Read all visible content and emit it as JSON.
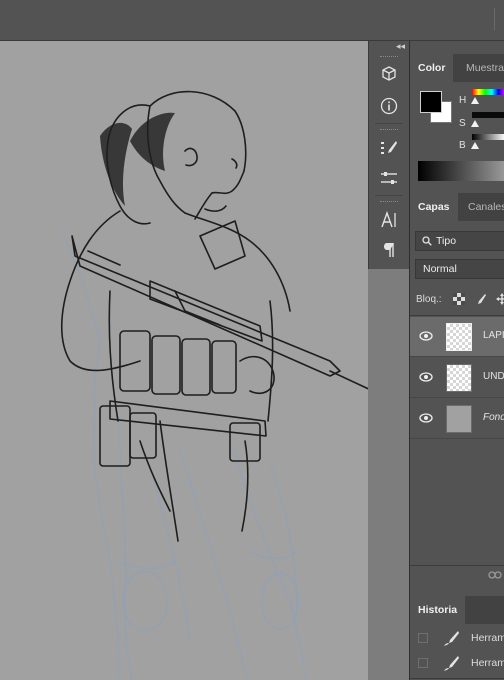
{
  "canvas": {
    "artwork": "figure-drawing-soldier-sketch"
  },
  "color_panel": {
    "tabs": [
      "Color",
      "Muestras"
    ],
    "slider_labels": [
      "H",
      "S",
      "B"
    ],
    "hsb_fill": [
      0.0,
      0.0,
      0.0
    ],
    "foreground_color": "#000000",
    "background_color": "#ffffff"
  },
  "layers_panel": {
    "tabs": [
      "Capas",
      "Canales"
    ],
    "filter_kind": "Tipo",
    "blend_mode": "Normal",
    "lock_label": "Bloq.:",
    "layers": [
      {
        "name": "LAPI",
        "visible": true,
        "selected": true,
        "italic": false
      },
      {
        "name": "UNDI",
        "visible": true,
        "selected": false,
        "italic": false
      },
      {
        "name": "Fond",
        "visible": true,
        "selected": false,
        "italic": true
      }
    ]
  },
  "history_panel": {
    "tab": "Historia",
    "items": [
      {
        "label": "Herram",
        "icon": "brush-icon"
      },
      {
        "label": "Herram",
        "icon": "brush-icon"
      }
    ]
  },
  "tool_strip_icons": [
    "3d-cube-icon",
    "info-icon",
    "brush-presets-icon",
    "brush-settings-icon",
    "character-icon",
    "paragraph-icon"
  ]
}
